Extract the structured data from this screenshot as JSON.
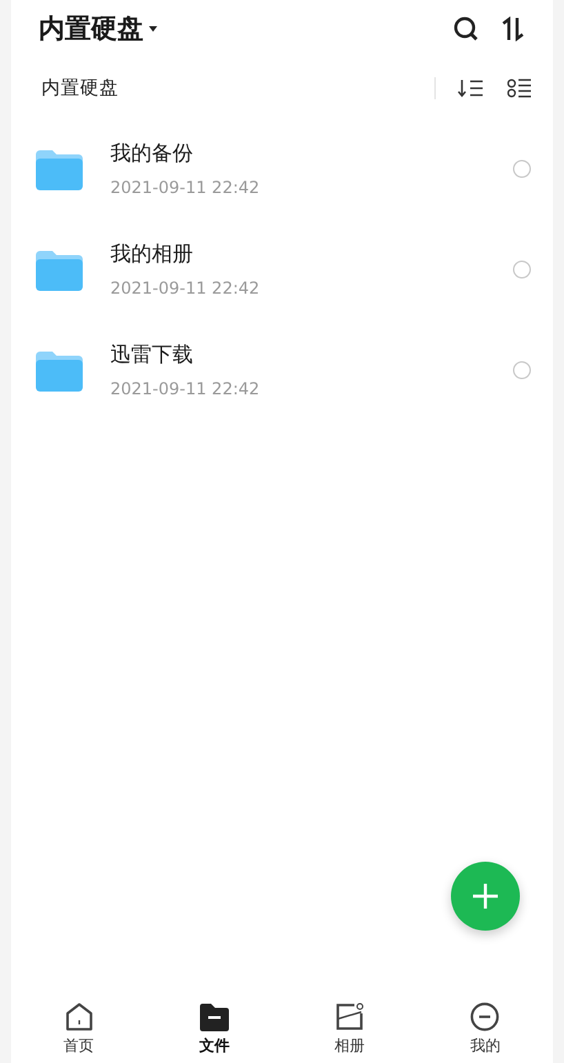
{
  "header": {
    "title": "内置硬盘"
  },
  "breadcrumb": {
    "path": "内置硬盘"
  },
  "files": [
    {
      "name": "我的备份",
      "date": "2021-09-11 22:42",
      "selected": false
    },
    {
      "name": "我的相册",
      "date": "2021-09-11 22:42",
      "selected": false
    },
    {
      "name": "迅雷下载",
      "date": "2021-09-11 22:42",
      "selected": false
    }
  ],
  "tabbar": [
    {
      "kind": "home",
      "label": "首页",
      "selected": false
    },
    {
      "kind": "files",
      "label": "文件",
      "selected": true
    },
    {
      "kind": "album",
      "label": "相册",
      "selected": false
    },
    {
      "kind": "me",
      "label": "我的",
      "selected": false
    }
  ]
}
